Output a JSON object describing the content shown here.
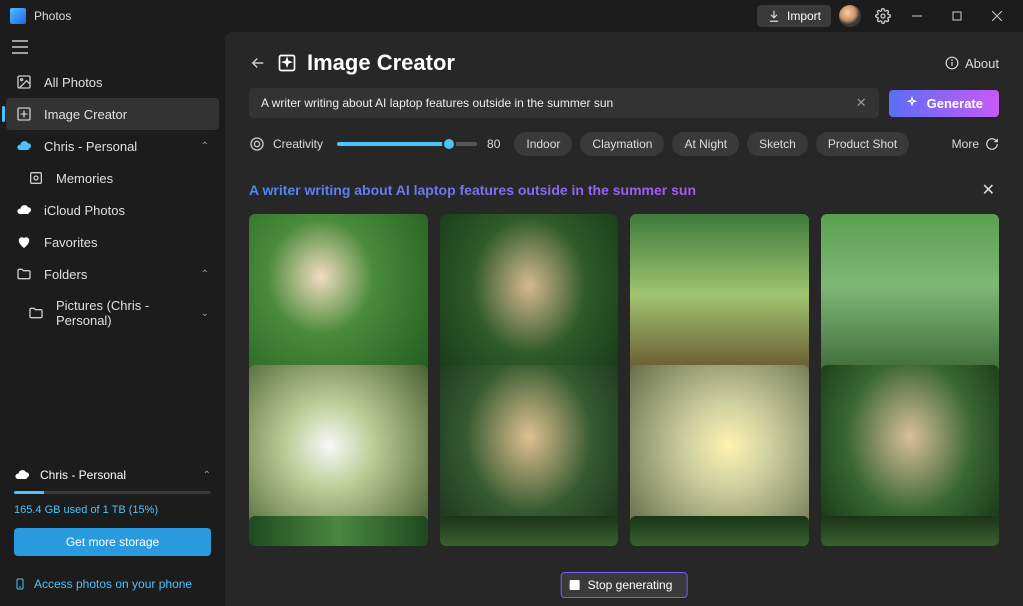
{
  "titlebar": {
    "app_name": "Photos",
    "import_label": "Import"
  },
  "sidebar": {
    "all_photos": "All Photos",
    "image_creator": "Image Creator",
    "account_label": "Chris - Personal",
    "memories": "Memories",
    "icloud": "iCloud Photos",
    "favorites": "Favorites",
    "folders": "Folders",
    "pictures_folder": "Pictures (Chris - Personal)"
  },
  "storage": {
    "account": "Chris - Personal",
    "used_text": "165.4 GB used of 1 TB (15%)",
    "percent": 15,
    "cta": "Get more storage",
    "phone_link": "Access photos on your phone"
  },
  "page": {
    "title": "Image Creator",
    "about": "About",
    "prompt_value": "A writer writing about AI laptop features outside in the summer sun",
    "generate_label": "Generate",
    "creativity_label": "Creativity",
    "creativity_value": "80",
    "styles": [
      "Indoor",
      "Claymation",
      "At Night",
      "Sketch",
      "Product Shot"
    ],
    "more_label": "More",
    "result_prompt": "A writer writing about AI laptop features outside in the summer sun",
    "stop_label": "Stop generating"
  }
}
